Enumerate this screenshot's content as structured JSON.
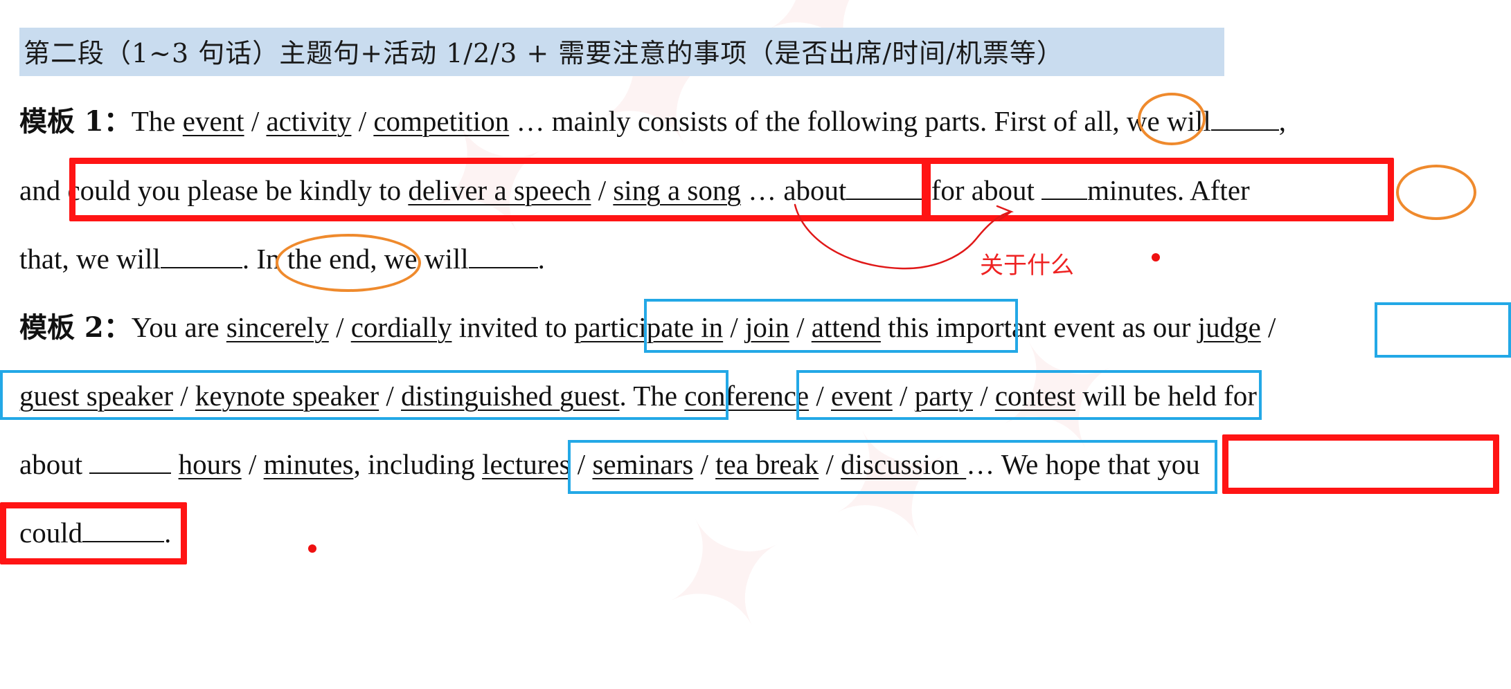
{
  "header": {
    "text": "第二段（1~3 句话）主题句+活动 1/2/3 + 需要注意的事项（是否出席/时间/机票等）"
  },
  "template1": {
    "label": "模板 1：",
    "l1": {
      "t1": "The ",
      "u1": "event",
      "s1": " / ",
      "u2": "activity",
      "s2": " / ",
      "u3": "competition",
      "t2": " … mainly consists of the following parts. ",
      "first": "First",
      "t3": " of all, we will",
      "t4": ","
    },
    "l2": {
      "t1": "and ",
      "t2": "could you please be kindly to ",
      "u1": "deliver a speech",
      "s1": " / ",
      "u2": "sing a song",
      "t3": " … ",
      "t4": "about",
      "t5": " for about ",
      "t6": "minutes. ",
      "after": "After"
    },
    "l3": {
      "t1": "that, we will",
      "t2": ". ",
      "end": "In the end",
      "t3": ", we will",
      "t4": "."
    }
  },
  "template2": {
    "label": "模板 2：",
    "l1": {
      "t1": "You are ",
      "u1": "sincerely",
      "s1": " / ",
      "u2": "cordially",
      "t2": " invited to ",
      "u3": "participate in",
      "s2": " / ",
      "u4": "join",
      "s3": " / ",
      "u5": "attend",
      "t3": " this important event as our ",
      "u6": "judge",
      "t4": " /"
    },
    "l2": {
      "u1": "guest speaker",
      "s1": " / ",
      "u2": "keynote speaker",
      "s2": " / ",
      "u3": "distinguished guest",
      "t1": ". The ",
      "u4": "conference",
      "s3": " / ",
      "u5": "event",
      "s4": " / ",
      "u6": "party",
      "s5": " / ",
      "u7": "contest",
      "t2": " will be held for"
    },
    "l3": {
      "t1": "about ",
      "t2": " ",
      "u1": "hours",
      "s1": " / ",
      "u2": "minutes",
      "t3": ", including ",
      "u3": "lectures",
      "s2": " / ",
      "u4": "seminars",
      "s3": " / ",
      "u5": "tea break",
      "s4": " / ",
      "u6": "discussion ",
      "t4": "… ",
      "t5": "We hope that you"
    },
    "l4": {
      "t1": "could",
      "t2": "."
    }
  },
  "annotation": {
    "note": "关于什么",
    "colors": {
      "red_box": "#ff1414",
      "blue_box": "#23a8e6",
      "orange_circle": "#ef8a2d",
      "header_band": "#c9dcef"
    }
  }
}
